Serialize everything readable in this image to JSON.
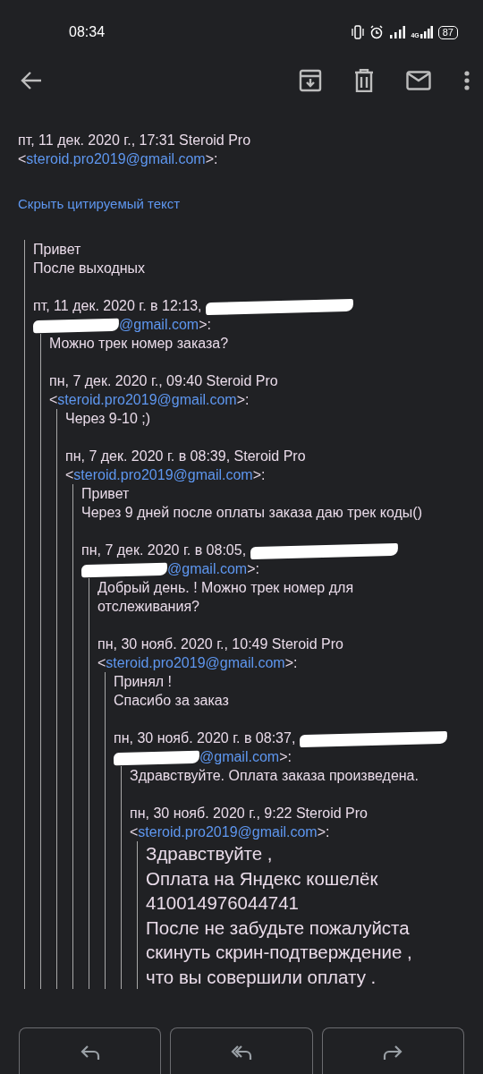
{
  "status_bar": {
    "time": "08:34",
    "network": "4G",
    "battery": "87"
  },
  "message": {
    "header": "пт, 11 дек. 2020 г., 17:31 Steroid Pro",
    "email_line": {
      "before": "<",
      "link": "steroid.pro2019@gmail.com",
      "after": ">:"
    },
    "hide_quoted_link": "Скрыть цитируемый текст",
    "quote": {
      "body": [
        "Привет",
        "После выходных"
      ],
      "header": "пт, 11 дек. 2020 г. в 12:13,",
      "header_redacted": true,
      "email_line": {
        "link": "@gmail.com",
        "after": ">:",
        "redacted": true
      },
      "quote": {
        "body": [
          "Можно трек номер заказа?"
        ],
        "header": "пн, 7 дек. 2020 г., 09:40 Steroid Pro",
        "header_redacted": false,
        "email_line": {
          "before": "<",
          "link": "steroid.pro2019@gmail.com",
          "after": ">:",
          "redacted": false
        },
        "quote": {
          "body": [
            "Через 9-10 ;)"
          ],
          "header": "пн, 7 дек. 2020 г. в 08:39, Steroid Pro",
          "header_redacted": false,
          "email_line": {
            "before": "<",
            "link": "steroid.pro2019@gmail.com",
            "after": ">:",
            "redacted": false
          },
          "quote": {
            "body": [
              "Привет",
              "Через 9 дней после оплаты заказа даю трек коды()"
            ],
            "header": "пн, 7 дек. 2020 г. в 08:05,",
            "header_redacted": true,
            "email_line": {
              "link": "@gmail.com",
              "after": ">:",
              "redacted": true
            },
            "quote": {
              "body": [
                "Добрый день. ! Можно трек номер для отслеживания?"
              ],
              "header": "пн, 30 нояб. 2020 г., 10:49 Steroid Pro",
              "header_redacted": false,
              "email_line": {
                "before": "<",
                "link": "steroid.pro2019@gmail.com",
                "after": ">:",
                "redacted": false
              },
              "quote": {
                "body": [
                  "Принял !",
                  "Спасибо за заказ"
                ],
                "header": "пн, 30 нояб. 2020 г. в 08:37,",
                "header_redacted": true,
                "email_line": {
                  "link": "@gmail.com",
                  "after": ">:",
                  "redacted": true
                },
                "quote": {
                  "body": [
                    "Здравствуйте. Оплата заказа произведена."
                  ],
                  "header": "пн, 30 нояб. 2020 г., 9:22 Steroid Pro",
                  "header_redacted": false,
                  "email_line": {
                    "before": "<",
                    "link": "steroid.pro2019@gmail.com",
                    "after": ">:",
                    "redacted": false
                  },
                  "quote": {
                    "kind": "large",
                    "body": [
                      "Здравствуйте ,",
                      "Оплата на Яндекс кошелёк",
                      "410014976044741",
                      "После не забудьте пожалуйста скинуть скрин-подтверждение , что вы совершили оплату ."
                    ]
                  }
                }
              }
            }
          }
        }
      }
    }
  },
  "actions": [
    {
      "kind": "reply"
    },
    {
      "kind": "reply_all"
    },
    {
      "kind": "forward"
    }
  ]
}
